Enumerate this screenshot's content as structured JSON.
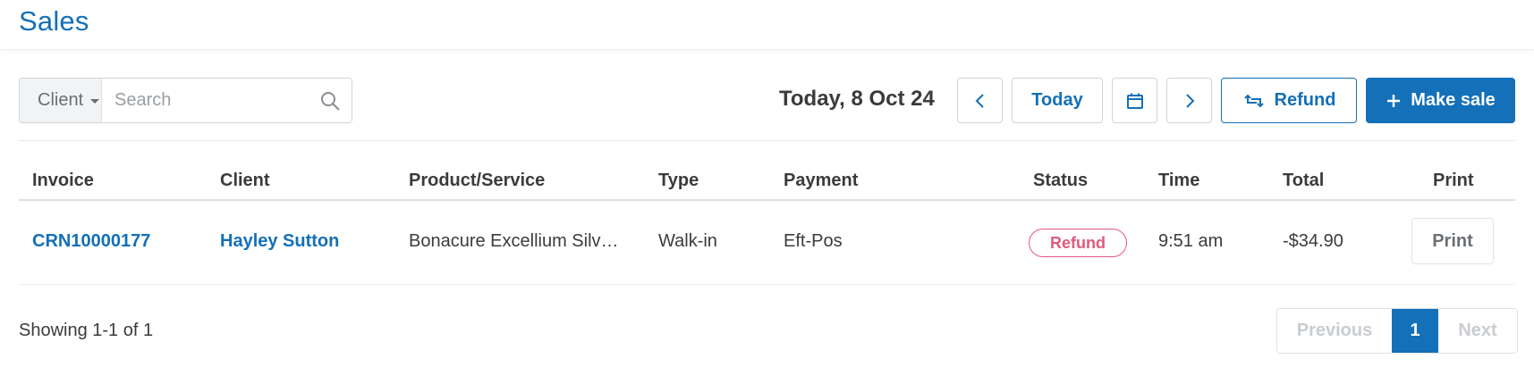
{
  "header": {
    "title": "Sales"
  },
  "toolbar": {
    "client_filter": "Client",
    "search_placeholder": "Search",
    "date_label": "Today, 8 Oct 24",
    "today_label": "Today",
    "refund_label": "Refund",
    "make_sale_label": "Make sale"
  },
  "table": {
    "columns": [
      "Invoice",
      "Client",
      "Product/Service",
      "Type",
      "Payment",
      "Status",
      "Time",
      "Total",
      "Print"
    ],
    "rows": [
      {
        "invoice": "CRN10000177",
        "client": "Hayley Sutton",
        "product": "Bonacure Excellium Silver Shampoo",
        "type": "Walk-in",
        "payment": "Eft-Pos",
        "status": "Refund",
        "time": "9:51 am",
        "total": "-$34.90",
        "print_label": "Print"
      }
    ]
  },
  "footer": {
    "showing": "Showing 1-1 of 1",
    "pagination": {
      "previous": "Previous",
      "current": "1",
      "next": "Next"
    }
  },
  "colors": {
    "accent": "#1470b8",
    "refund_status": "#e05a7c"
  },
  "icons": {
    "search": "search-icon",
    "prev": "chevron-left-icon",
    "next": "chevron-right-icon",
    "calendar": "calendar-icon",
    "refund": "refund-arrows-icon",
    "add": "plus-icon",
    "caret": "caret-down-icon"
  }
}
